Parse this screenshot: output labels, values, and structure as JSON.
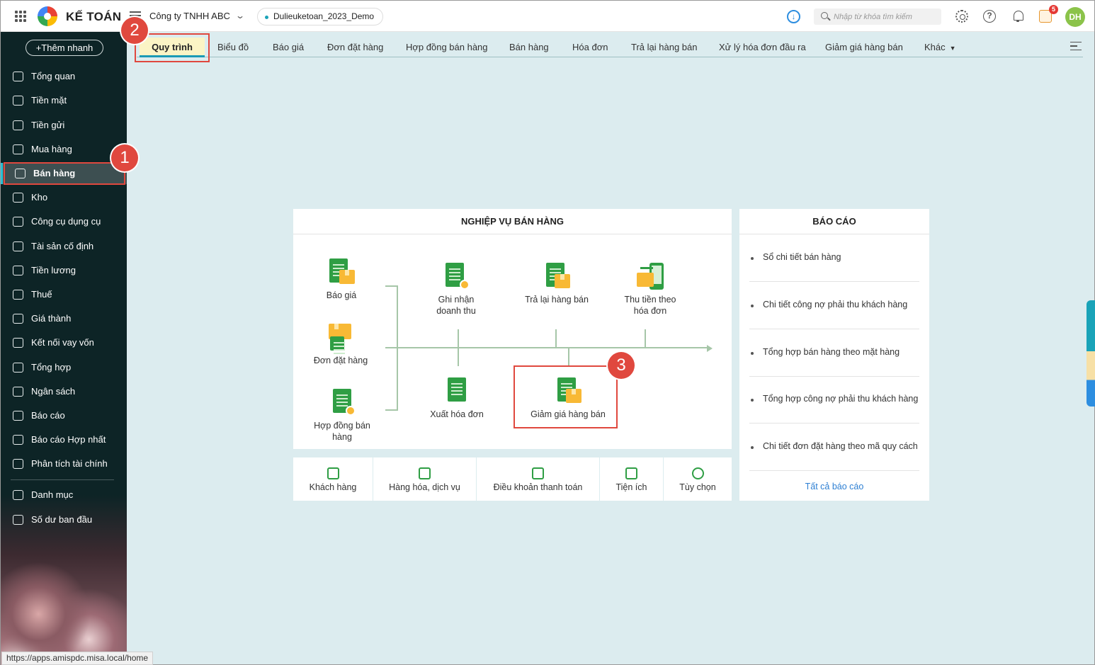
{
  "topbar": {
    "brand": "KẾ TOÁN",
    "company": "Công ty TNHH ABC",
    "dataset": "Dulieuketoan_2023_Demo",
    "search_placeholder": "Nhập từ khóa tìm kiếm",
    "notification_count": "5",
    "avatar_initials": "DH"
  },
  "sidebar": {
    "quick_add": "Thêm nhanh",
    "items": [
      {
        "label": "Tổng quan",
        "icon": "dashboard-icon"
      },
      {
        "label": "Tiền mặt",
        "icon": "cash-icon"
      },
      {
        "label": "Tiền gửi",
        "icon": "bank-icon"
      },
      {
        "label": "Mua hàng",
        "icon": "shopping-bag-icon"
      },
      {
        "label": "Bán hàng",
        "icon": "cart-icon"
      },
      {
        "label": "Kho",
        "icon": "warehouse-icon"
      },
      {
        "label": "Công cụ dụng cụ",
        "icon": "tools-icon"
      },
      {
        "label": "Tài sản cố định",
        "icon": "car-icon"
      },
      {
        "label": "Tiền lương",
        "icon": "salary-icon"
      },
      {
        "label": "Thuế",
        "icon": "tax-icon"
      },
      {
        "label": "Giá thành",
        "icon": "price-tag-icon"
      },
      {
        "label": "Kết nối vay vốn",
        "icon": "loan-icon"
      },
      {
        "label": "Tổng hợp",
        "icon": "summary-icon"
      },
      {
        "label": "Ngân sách",
        "icon": "budget-icon"
      },
      {
        "label": "Báo cáo",
        "icon": "bar-chart-icon"
      },
      {
        "label": "Báo cáo Hợp nhất",
        "icon": "consolidated-report-icon"
      },
      {
        "label": "Phân tích tài chính",
        "icon": "analytics-icon"
      },
      {
        "label": "Danh mục",
        "icon": "list-icon"
      },
      {
        "label": "Số dư ban đầu",
        "icon": "opening-balance-icon"
      }
    ],
    "active_item": "Bán hàng"
  },
  "tabs": [
    "Quy trình",
    "Biểu đồ",
    "Báo giá",
    "Đơn đặt hàng",
    "Hợp đồng bán hàng",
    "Bán hàng",
    "Hóa đơn",
    "Trả lại hàng bán",
    "Xử lý hóa đơn đầu ra",
    "Giảm giá hàng bán",
    "Khác"
  ],
  "active_tab": "Quy trình",
  "process": {
    "title": "NGHIỆP VỤ BÁN HÀNG",
    "steps": {
      "bao_gia": "Báo giá",
      "don_dat_hang": "Đơn đặt hàng",
      "hop_dong": "Hợp đồng bán hàng",
      "ghi_nhan": "Ghi nhận doanh thu",
      "tra_lai": "Trả lại hàng bán",
      "thu_tien": "Thu tiền theo hóa đơn",
      "xuat_hoa_don": "Xuất hóa đơn",
      "giam_gia": "Giảm giá hàng bán"
    }
  },
  "shortcuts": [
    "Khách hàng",
    "Hàng hóa, dịch vụ",
    "Điều khoản thanh toán",
    "Tiện ích",
    "Tùy chọn"
  ],
  "reports": {
    "title": "BÁO CÁO",
    "items": [
      "Sổ chi tiết bán hàng",
      "Chi tiết công nợ phải thu khách hàng",
      "Tổng hợp bán hàng theo mặt hàng",
      "Tổng hợp công nợ phải thu khách hàng",
      "Chi tiết đơn đặt hàng theo mã quy cách"
    ],
    "all_link": "Tất cả báo cáo"
  },
  "annotations": [
    "1",
    "2",
    "3"
  ],
  "status_url": "https://apps.amispdc.misa.local/home",
  "colors": {
    "sidebar_bg": "#0d2426",
    "accent": "#1a9ab5",
    "highlight": "#e0483e",
    "content_bg": "#dcecef"
  }
}
